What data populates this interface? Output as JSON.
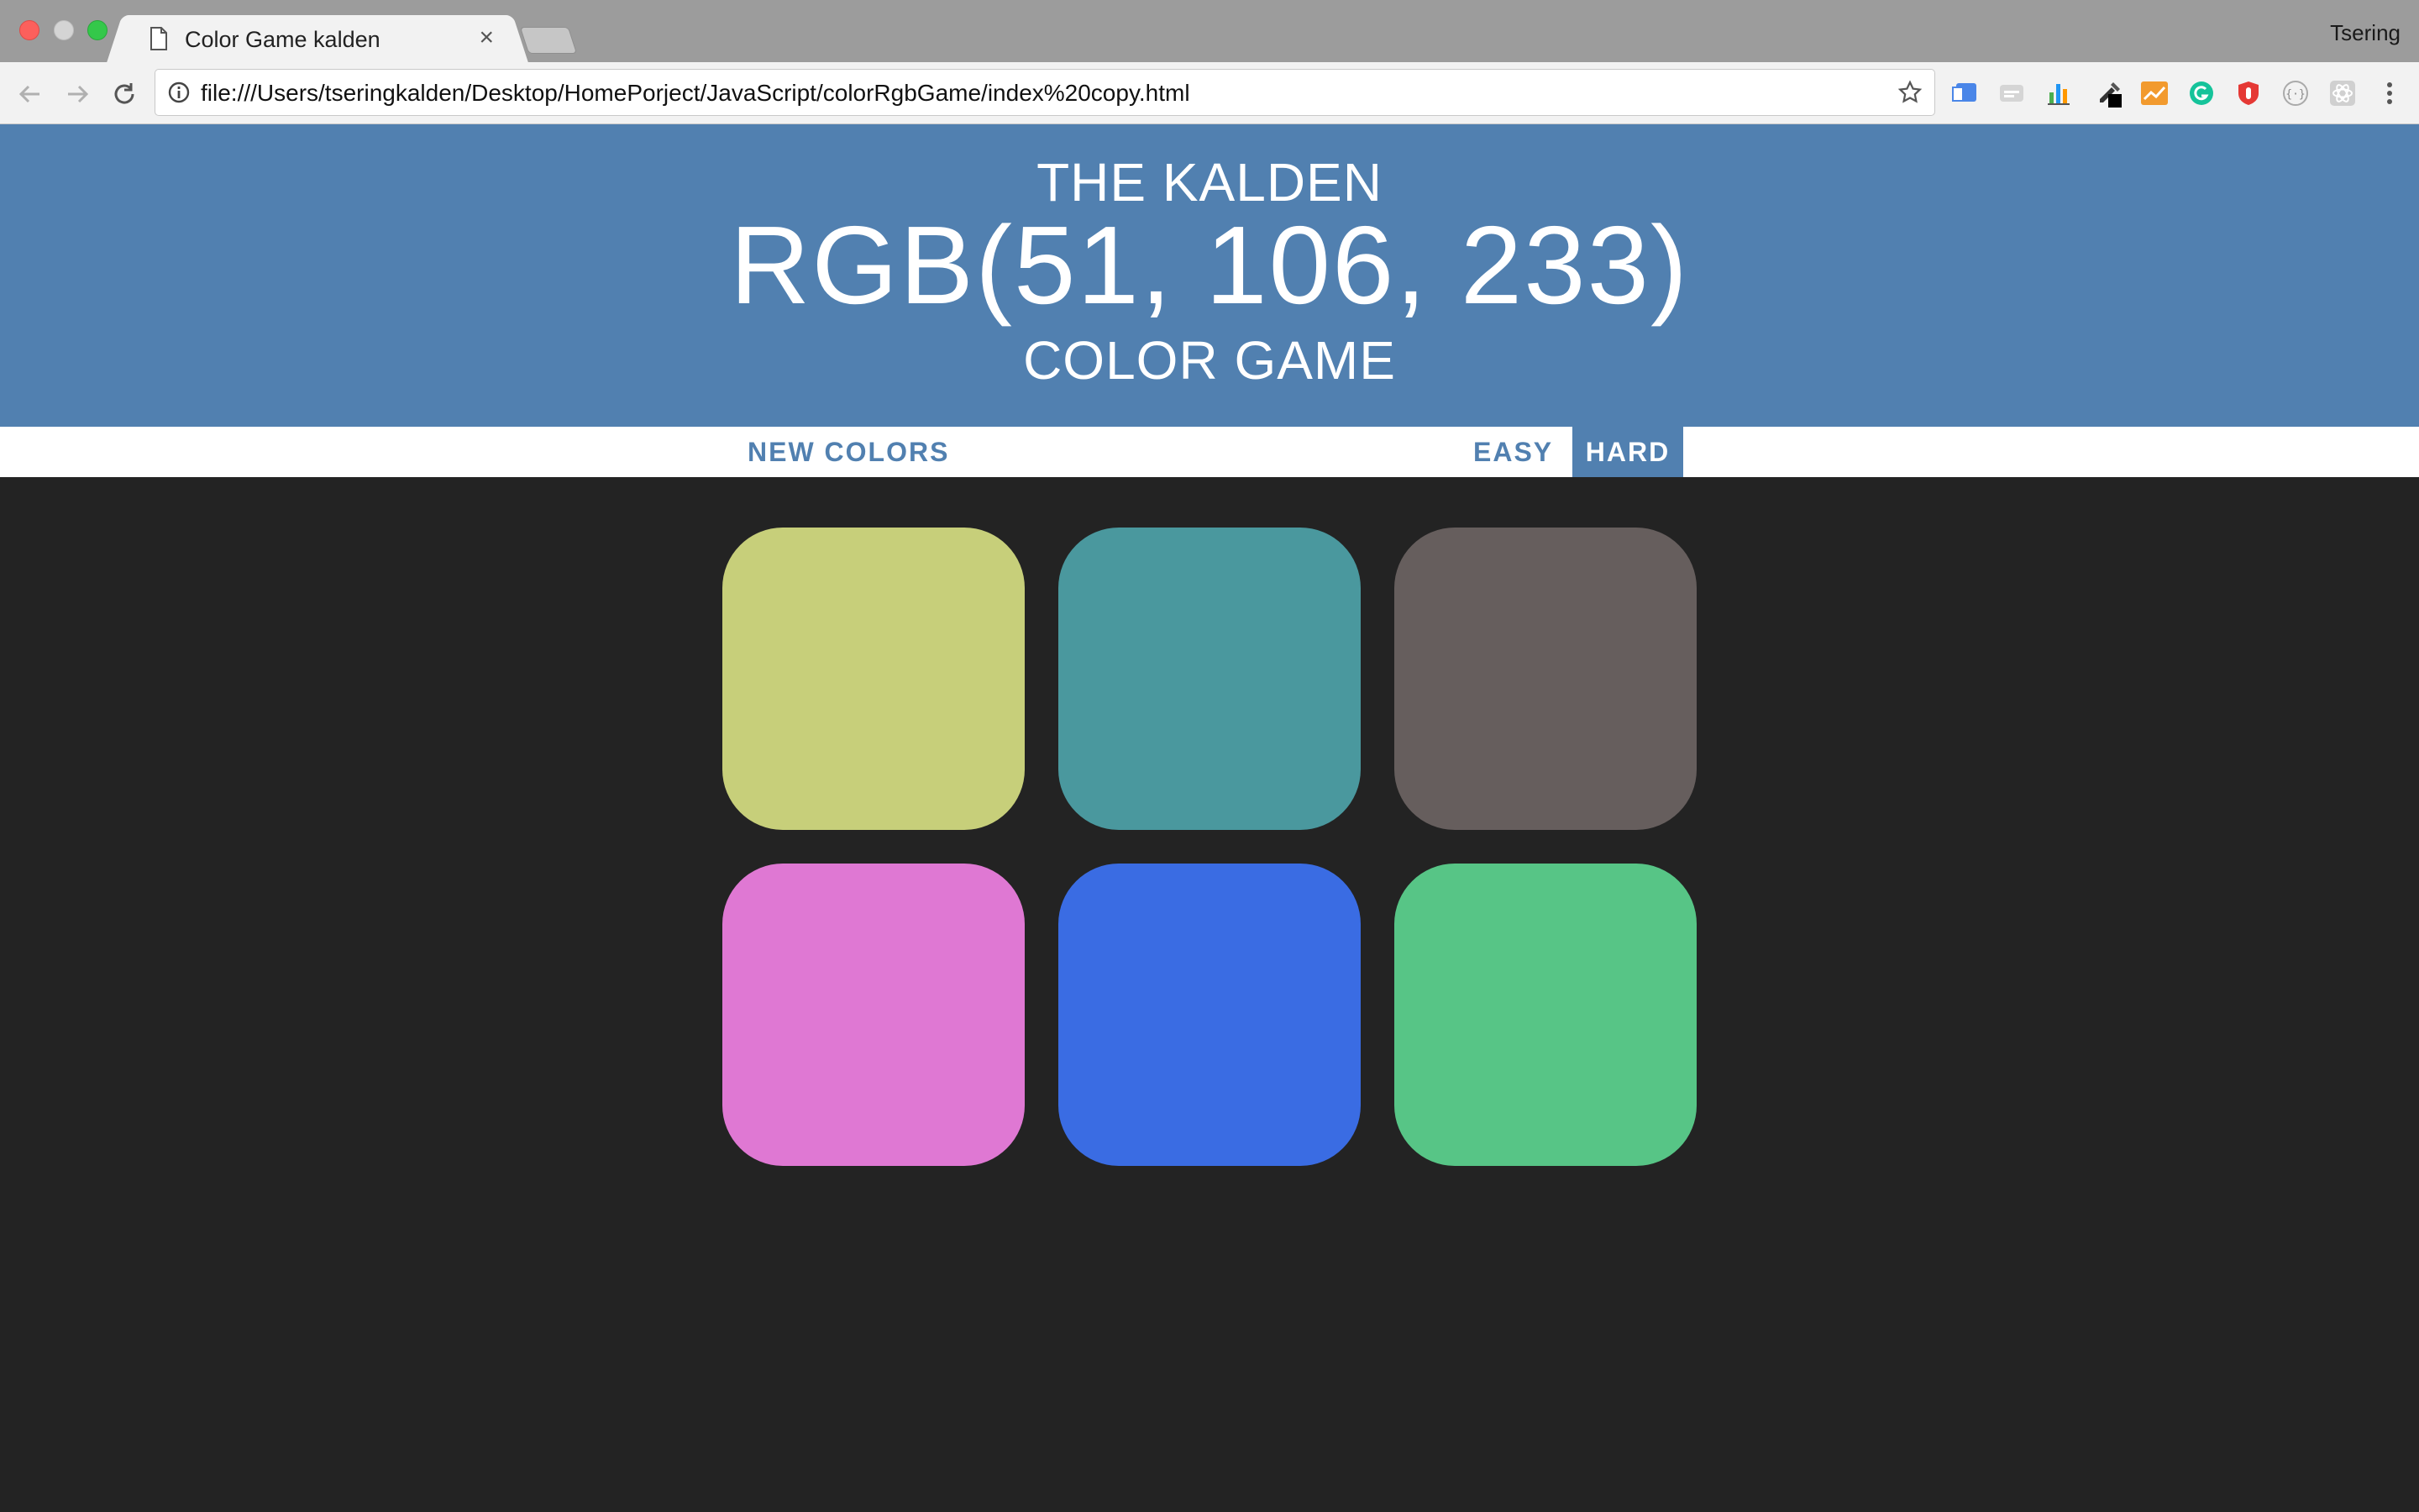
{
  "browser": {
    "tab_title": "Color Game kalden",
    "tab_close": "×",
    "profile_name": "Tsering",
    "url": "file:///Users/tseringkalden/Desktop/HomePorject/JavaScript/colorRgbGame/index%20copy.html",
    "extensions": [
      "translate-icon",
      "caption-icon",
      "chart-icon",
      "eyedropper-icon",
      "trend-icon",
      "grammarly-icon",
      "shield-icon",
      "braces-icon",
      "react-icon",
      "menu-icon"
    ]
  },
  "game": {
    "heading_top": "THE KALDEN",
    "target_rgb": "RGB(51, 106, 233)",
    "heading_bottom": "COLOR GAME",
    "new_colors_label": "NEW COLORS",
    "easy_label": "EASY",
    "hard_label": "HARD",
    "selected_mode": "HARD",
    "accent_color": "#5180b0",
    "background_color": "#232323",
    "squares": [
      {
        "color": "#c7cf7a"
      },
      {
        "color": "#4a989e"
      },
      {
        "color": "#665e5d"
      },
      {
        "color": "#df78d3"
      },
      {
        "color": "#3a6ce3"
      },
      {
        "color": "#57c586"
      }
    ]
  }
}
